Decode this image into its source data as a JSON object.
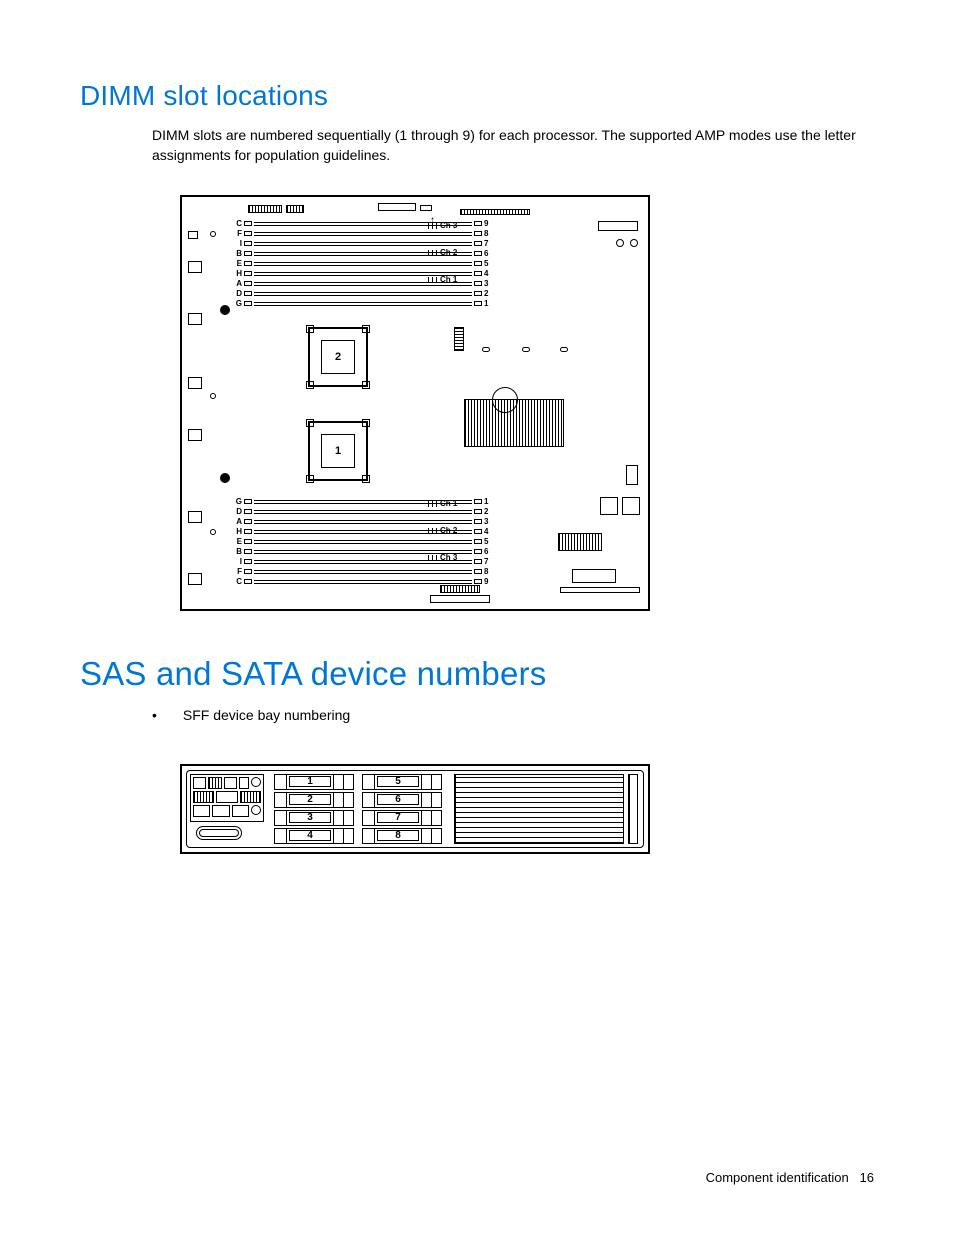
{
  "section1": {
    "title": "DIMM slot locations",
    "body": "DIMM slots are numbered sequentially (1 through 9) for each processor. The supported AMP modes use the letter assignments for population guidelines."
  },
  "section2": {
    "title": "SAS and SATA device numbers",
    "bullet": "SFF device bay numbering"
  },
  "diagram1": {
    "cpu_top": "2",
    "cpu_bottom": "1",
    "bank_top": {
      "letters": [
        "C",
        "F",
        "I",
        "B",
        "E",
        "H",
        "A",
        "D",
        "G"
      ],
      "numbers": [
        "9",
        "8",
        "7",
        "6",
        "5",
        "4",
        "3",
        "2",
        "1"
      ]
    },
    "bank_bottom": {
      "letters": [
        "G",
        "D",
        "A",
        "H",
        "E",
        "B",
        "I",
        "F",
        "C"
      ],
      "numbers": [
        "1",
        "2",
        "3",
        "4",
        "5",
        "6",
        "7",
        "8",
        "9"
      ]
    },
    "channels": [
      "Ch 3",
      "Ch 2",
      "Ch 1"
    ],
    "channels_bottom": [
      "Ch 1",
      "Ch 2",
      "Ch 3"
    ]
  },
  "diagram2": {
    "col1": [
      "1",
      "2",
      "3",
      "4"
    ],
    "col2": [
      "5",
      "6",
      "7",
      "8"
    ]
  },
  "footer": {
    "section": "Component identification",
    "page": "16"
  }
}
